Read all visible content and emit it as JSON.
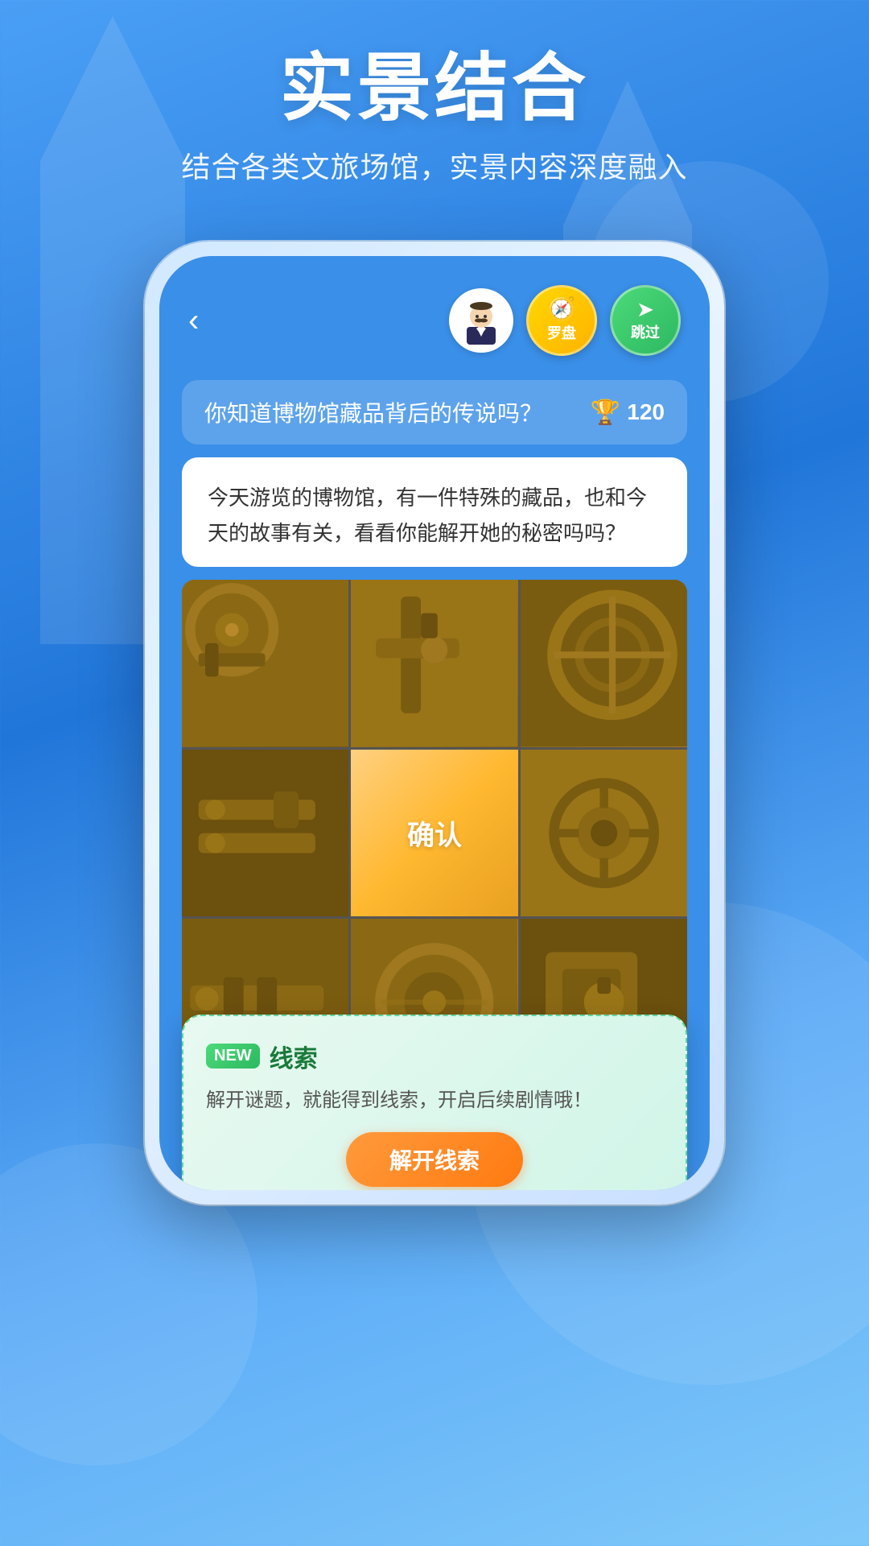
{
  "background": {
    "gradient_start": "#4a9ff5",
    "gradient_end": "#2176d9"
  },
  "header": {
    "main_title": "实景结合",
    "sub_title": "结合各类文旅场馆，实景内容深度融入"
  },
  "phone": {
    "back_button_label": "‹",
    "compass_button": {
      "icon": "🧭",
      "label": "罗盘"
    },
    "skip_button": {
      "icon": "↪",
      "label": "跳过"
    },
    "question_bar": {
      "text": "你知道博物馆藏品背后的传说吗？",
      "score": "120",
      "trophy_icon": "🏆"
    },
    "description": "今天游览的博物馆，有一件特殊的藏品，也和今天的故事有关，看看你能解开她的秘密吗吗？",
    "puzzle": {
      "confirm_label": "确认",
      "cells": [
        {
          "id": "tl",
          "type": "image"
        },
        {
          "id": "tc",
          "type": "image"
        },
        {
          "id": "tr",
          "type": "image"
        },
        {
          "id": "ml",
          "type": "image"
        },
        {
          "id": "mc",
          "type": "confirm"
        },
        {
          "id": "mr",
          "type": "image"
        },
        {
          "id": "bl",
          "type": "image"
        },
        {
          "id": "bc",
          "type": "image"
        },
        {
          "id": "br",
          "type": "image"
        }
      ]
    },
    "clue_card": {
      "new_badge": "NEW",
      "title": "线索",
      "description": "解开谜题，就能得到线索，开启后续剧情哦！",
      "unlock_button": "解开线索"
    }
  }
}
